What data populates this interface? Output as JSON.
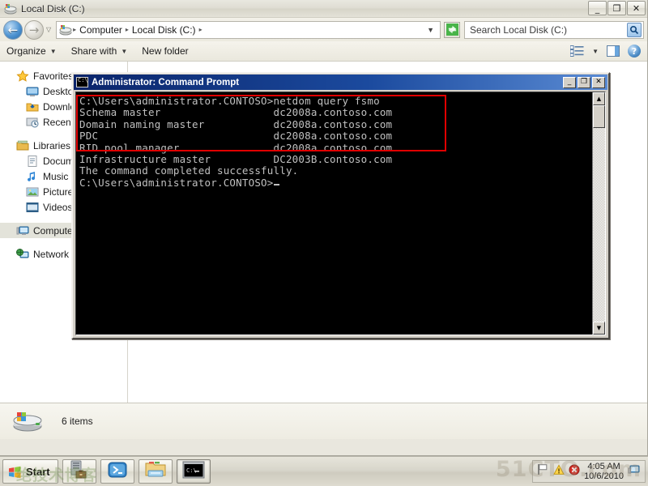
{
  "explorer": {
    "title": "Local Disk (C:)",
    "title_icon": "drive-icon",
    "window_buttons": {
      "minimize": "_",
      "maximize": "❐",
      "close": "✕"
    },
    "address": {
      "back_icon": "←",
      "forward_icon": "→",
      "history_caret": "▽",
      "crumbs": [
        "Computer",
        "Local Disk (C:)"
      ],
      "separator": "▸",
      "dropdown_caret": "▼",
      "refresh_icon": "refresh-icon"
    },
    "search": {
      "placeholder": "Search Local Disk (C:)",
      "icon": "🔍"
    },
    "toolbar": {
      "organize": "Organize",
      "share_with": "Share with",
      "new_folder": "New folder",
      "caret": "▼",
      "views_icon": "views-icon",
      "preview_pane_icon": "preview-pane-icon",
      "help_icon": "?"
    },
    "navpane": {
      "groups": [
        {
          "label": "Favorites",
          "icon": "star-icon",
          "items": [
            {
              "label": "Desktop",
              "icon": "desktop-icon"
            },
            {
              "label": "Downloads",
              "icon": "downloads-icon"
            },
            {
              "label": "Recent Places",
              "icon": "recent-places-icon"
            }
          ]
        },
        {
          "label": "Libraries",
          "icon": "libraries-icon",
          "items": [
            {
              "label": "Documents",
              "icon": "documents-icon"
            },
            {
              "label": "Music",
              "icon": "music-icon"
            },
            {
              "label": "Pictures",
              "icon": "pictures-icon"
            },
            {
              "label": "Videos",
              "icon": "videos-icon"
            }
          ]
        },
        {
          "label": "Computer",
          "icon": "computer-icon",
          "selected": true,
          "items": []
        },
        {
          "label": "Network",
          "icon": "network-icon",
          "items": []
        }
      ]
    },
    "status": {
      "item_count": "6 items",
      "icon": "drive-icon"
    }
  },
  "console": {
    "title": "Administrator: Command Prompt",
    "icon": "cmd-icon",
    "window_buttons": {
      "minimize": "_",
      "maximize": "❐",
      "close": "✕"
    },
    "scrollbar": {
      "up": "▲",
      "down": "▼"
    },
    "highlight_color": "#e00000",
    "lines": [
      "C:\\Users\\administrator.CONTOSO>netdom query fsmo",
      "Schema master                  dc2008a.contoso.com",
      "Domain naming master           dc2008a.contoso.com",
      "PDC                            dc2008a.contoso.com",
      "RID pool manager               dc2008a.contoso.com",
      "Infrastructure master          DC2003B.contoso.com",
      "The command completed successfully.",
      "",
      ""
    ],
    "prompt": "C:\\Users\\administrator.CONTOSO>",
    "fsmo_roles": [
      {
        "role": "Schema master",
        "holder": "dc2008a.contoso.com"
      },
      {
        "role": "Domain naming master",
        "holder": "dc2008a.contoso.com"
      },
      {
        "role": "PDC",
        "holder": "dc2008a.contoso.com"
      },
      {
        "role": "RID pool manager",
        "holder": "dc2008a.contoso.com"
      },
      {
        "role": "Infrastructure master",
        "holder": "DC2003B.contoso.com"
      }
    ]
  },
  "taskbar": {
    "start_label": "Start",
    "apps": [
      {
        "name": "server-manager",
        "icon": "server-manager-icon",
        "active": false
      },
      {
        "name": "powershell",
        "icon": "powershell-icon",
        "active": false
      },
      {
        "name": "windows-explorer",
        "icon": "explorer-icon",
        "active": false
      },
      {
        "name": "command-prompt",
        "icon": "cmd-icon",
        "active": true
      }
    ],
    "tray": {
      "flag_icon": "flag-icon",
      "warning_icon": "warning-icon",
      "error_icon": "error-icon",
      "network_icon": "network-tray-icon",
      "time": "4:05 AM",
      "date": "10/6/2010"
    }
  },
  "watermark": {
    "text": "51CTO.com",
    "secondary": "绝技术博客"
  }
}
